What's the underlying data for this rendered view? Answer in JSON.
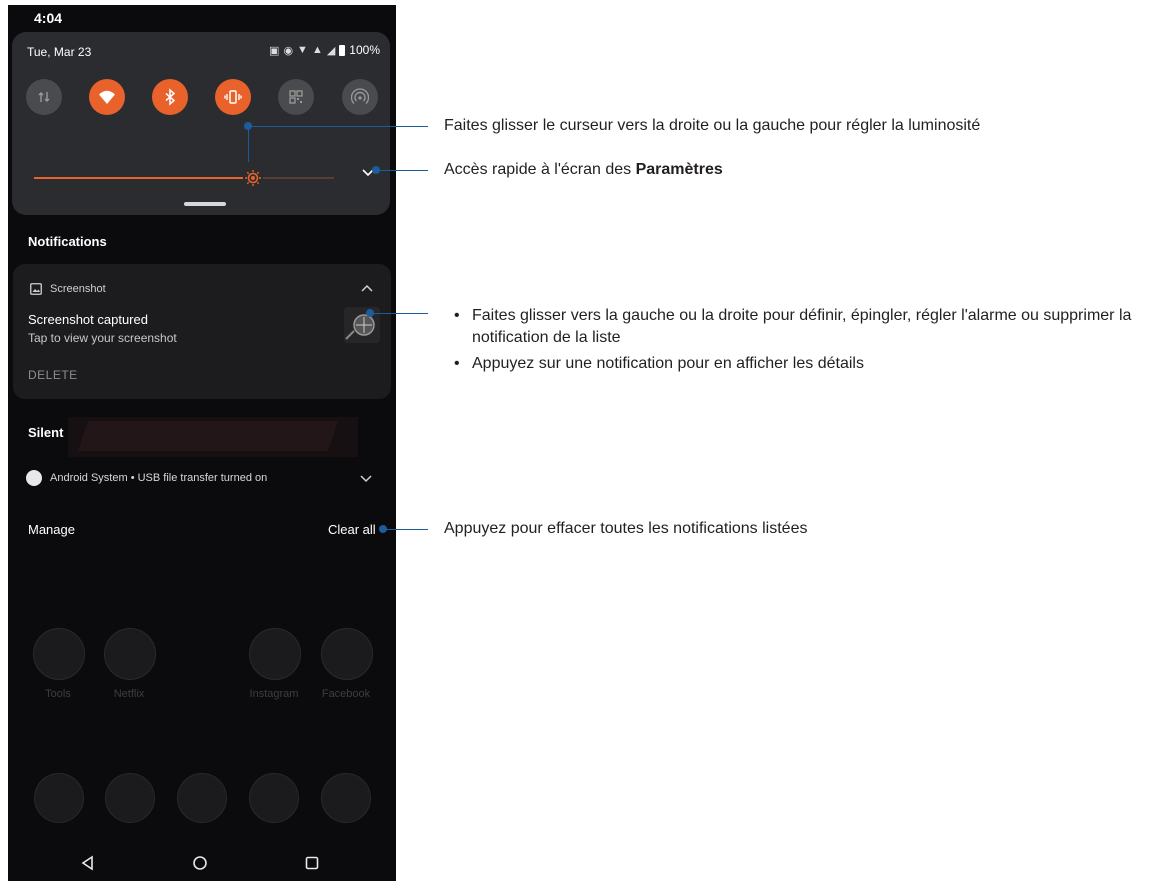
{
  "status_bar": {
    "time": "4:04"
  },
  "quick_settings": {
    "date": "Tue, Mar 23",
    "battery": "100%",
    "tiles": [
      {
        "icon": "data-transfer-icon",
        "state": "off"
      },
      {
        "icon": "wifi-icon",
        "state": "on"
      },
      {
        "icon": "bluetooth-icon",
        "state": "on"
      },
      {
        "icon": "vibrate-icon",
        "state": "on"
      },
      {
        "icon": "qr-scanner-icon",
        "state": "off"
      },
      {
        "icon": "hotspot-icon",
        "state": "off"
      }
    ],
    "brightness_level": 0.73
  },
  "notifications": {
    "header": "Notifications",
    "card": {
      "app_name": "Screenshot",
      "title": "Screenshot captured",
      "text": "Tap to view your screenshot",
      "action": "DELETE"
    },
    "silent_header": "Silent",
    "silent_item": "Android System • USB file transfer turned on",
    "manage": "Manage",
    "clear_all": "Clear all"
  },
  "home": {
    "apps": [
      "Tools",
      "Netflix",
      "Instagram",
      "Facebook"
    ]
  },
  "callouts": {
    "brightness": "Faites glisser le curseur vers la droite ou la gauche pour régler la luminosité",
    "settings_prefix": "Accès rapide à l'écran des ",
    "settings_bold": "Paramètres",
    "bullet_mark": "•",
    "bullet1": "Faites glisser vers la gauche ou la droite pour définir, épingler, régler l'alarme ou supprimer la notification de la liste",
    "bullet2": "Appuyez sur une notification pour en afficher les détails",
    "clear": "Appuyez pour effacer toutes les notifications listées"
  },
  "colors": {
    "accent_orange": "#e9622b",
    "callout_blue": "#1d5c9b"
  }
}
